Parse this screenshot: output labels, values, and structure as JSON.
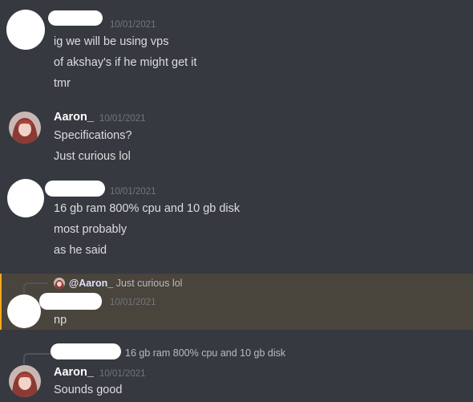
{
  "messages": [
    {
      "timestamp": "10/01/2021",
      "lines": [
        "ig we will be using vps",
        "of akshay's if he might get it",
        "tmr"
      ]
    },
    {
      "author": "Aaron_",
      "timestamp": "10/01/2021",
      "lines": [
        "Specifications?",
        "Just curious lol"
      ]
    },
    {
      "timestamp": "10/01/2021",
      "lines": [
        "16 gb ram 800% cpu and 10 gb disk",
        "most probably",
        "as he said"
      ]
    },
    {
      "reply_mention": "@Aaron_",
      "reply_text": "Just curious lol",
      "timestamp": "10/01/2021",
      "lines": [
        "np"
      ]
    },
    {
      "reply_text": "16 gb ram 800% cpu and 10 gb disk",
      "author": "Aaron_",
      "timestamp": "10/01/2021",
      "lines": [
        "Sounds good"
      ]
    }
  ],
  "colors": {
    "background": "#36393f",
    "mention_highlight": "#49443c",
    "mention_bar": "#faa81a",
    "timestamp": "#72767d",
    "text": "#dcddde"
  }
}
